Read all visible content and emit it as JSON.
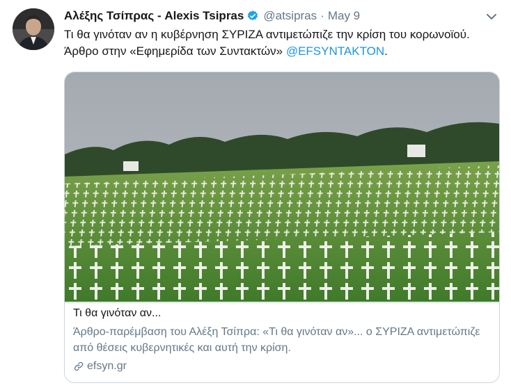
{
  "tweet": {
    "display_name": "Αλέξης Τσίπρας - Alexis Tsipras",
    "handle": "@atsipras",
    "separator": "·",
    "date": "May 9",
    "text_part1": "Τι θα γινόταν αν η κυβέρνηση ΣΥΡΙΖΑ αντιμετώπιζε την κρίση του κορωνοϊού.  Άρθρο στην «Εφημερίδα των Συντακτών» ",
    "mention": "@EFSYNTAKTON",
    "text_part2": "."
  },
  "card": {
    "title": "Τι θα γινόταν αν...",
    "description": "Άρθρο-παρέμβαση του Αλέξη Τσίπρα: «Τι θα γινόταν αν»... ο ΣΥΡΙΖΑ αντιμετώπιζε από θέσεις κυβερνητικές και αυτή την κρίση.",
    "domain": "efsyn.gr"
  },
  "colors": {
    "accent": "#1b95e0",
    "muted": "#657786",
    "text": "#14171a",
    "border": "#ccd6dd"
  },
  "icons": [
    "verified-badge-icon",
    "caret-down-icon",
    "link-icon"
  ]
}
